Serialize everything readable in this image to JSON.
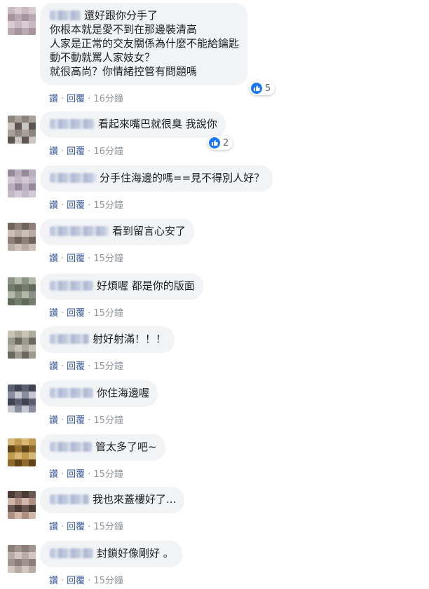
{
  "colors": {
    "bubble": "#f2f3f5",
    "link": "#385898",
    "muted": "#90949c",
    "like": "#1877f2"
  },
  "action_labels": {
    "like": "讚",
    "reply": "回覆"
  },
  "comments": [
    {
      "lines": [
        "還好跟你分手了",
        "你根本就是愛不到在那邊裝清高",
        "人家是正常的交友關係為什麼不能給鑰匙",
        "動不動就罵人家妓女？",
        "就很高尚？你情緒控管有問題嗎"
      ],
      "time": "16分鐘",
      "reactions": "5",
      "avatar_tones": [
        "#c9b9c1",
        "#b8a8b0",
        "#d8ccd2",
        "#a7949f"
      ]
    },
    {
      "lines": [
        "看起來嘴巴就很臭 我說你"
      ],
      "time": "16分鐘",
      "reactions": "2",
      "avatar_tones": [
        "#ccc6c2",
        "#8b847f",
        "#5e5450",
        "#a9a09a"
      ]
    },
    {
      "lines": [
        "分手住海邊的嗎==見不得別人好？"
      ],
      "time": "15分鐘",
      "avatar_tones": [
        "#b9aebe",
        "#d4c9d6",
        "#97889a",
        "#c4bac7"
      ]
    },
    {
      "lines": [
        "看到留言心安了"
      ],
      "time": "15分鐘",
      "avatar_tones": [
        "#b7aba3",
        "#8e8079",
        "#cbbfb7",
        "#6e635d"
      ]
    },
    {
      "lines": [
        "好煩喔 都是你的版面"
      ],
      "time": "15分鐘",
      "avatar_tones": [
        "#8b9386",
        "#5f6a5b",
        "#b3b8a9",
        "#747d6d"
      ]
    },
    {
      "lines": [
        "射好射滿！！！"
      ],
      "time": "15分鐘",
      "avatar_tones": [
        "#9c998f",
        "#c9c4b6",
        "#6b685e",
        "#aeab9f"
      ]
    },
    {
      "lines": [
        "你住海邊喔"
      ],
      "time": "15分鐘",
      "avatar_tones": [
        "#3f4352",
        "#8a8ea0",
        "#5b5f70",
        "#c6c7d0"
      ]
    },
    {
      "lines": [
        "管太多了吧~"
      ],
      "time": "15分鐘",
      "avatar_tones": [
        "#8f6a2a",
        "#c29c4e",
        "#5f4418",
        "#d8b777"
      ]
    },
    {
      "lines": [
        "我也來蓋樓好了..."
      ],
      "time": "15分鐘",
      "avatar_tones": [
        "#4a3b35",
        "#b08f83",
        "#6d5751",
        "#d2b6ab"
      ]
    },
    {
      "lines": [
        "封鎖好像剛好 。"
      ],
      "time": "15分鐘",
      "avatar_tones": [
        "#b7aca6",
        "#8c7f79",
        "#d1c6c0",
        "#9f948e"
      ]
    }
  ]
}
